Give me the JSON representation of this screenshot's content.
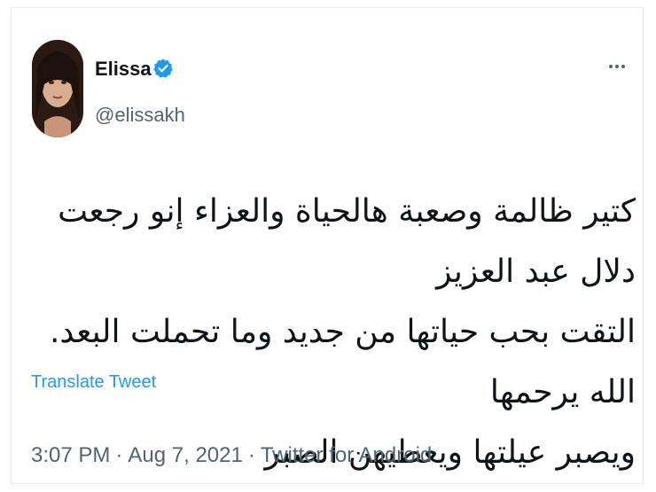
{
  "author": {
    "name": "Elissa",
    "handle": "@elissakh",
    "verified": true
  },
  "tweet": {
    "text": "كتير ظالمة  وصعبة هالحياة والعزاء إنو رجعت دلال عبد العزيز\nالتقت بحب حياتها من جديد وما تحملت البعد. الله يرحمها\nويصبر عيلتها ويعطيهن الصبر",
    "translate_label": "Translate Tweet"
  },
  "meta": {
    "time": "3:07 PM",
    "date": "Aug 7, 2021",
    "source": "Twitter for Android",
    "separator": "·"
  },
  "icons": {
    "verified": "verified-badge-icon",
    "more": "more-options-icon"
  },
  "colors": {
    "accent": "#1d9bf0",
    "secondary_text": "#536471",
    "primary_text": "#0f1419",
    "border": "#e6ecf0"
  }
}
